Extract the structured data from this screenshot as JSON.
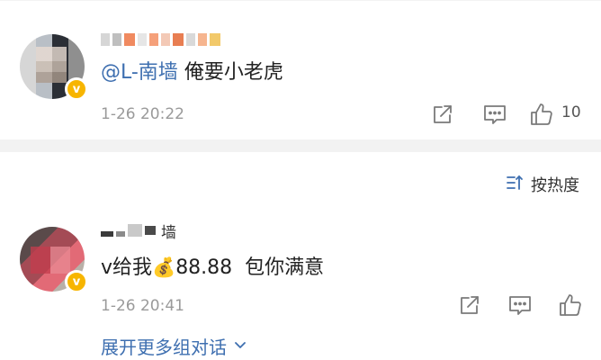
{
  "comments": [
    {
      "username": "",
      "mention": "@L-南墙",
      "text": "俺要小老虎",
      "time": "1-26 20:22",
      "likes": "10",
      "verified_badge": "v"
    },
    {
      "username": "",
      "name_suffix": "墙",
      "text_before": "v给我",
      "emoji": "💰",
      "text_after": "88.88  包你满意",
      "time": "1-26 20:41",
      "verified_badge": "v",
      "expand_label": "展开更多组对话"
    }
  ],
  "sort": {
    "label": "按热度"
  },
  "icons": {
    "share": "share-icon",
    "reply": "reply-icon",
    "like": "thumbs-up-icon",
    "sort": "sort-icon",
    "chevron": "chevron-down-icon"
  },
  "colors": {
    "link": "#3e6fb0",
    "timestamp": "#9a9a9a",
    "verified": "#f7b500",
    "divider": "#f2f2f2"
  }
}
